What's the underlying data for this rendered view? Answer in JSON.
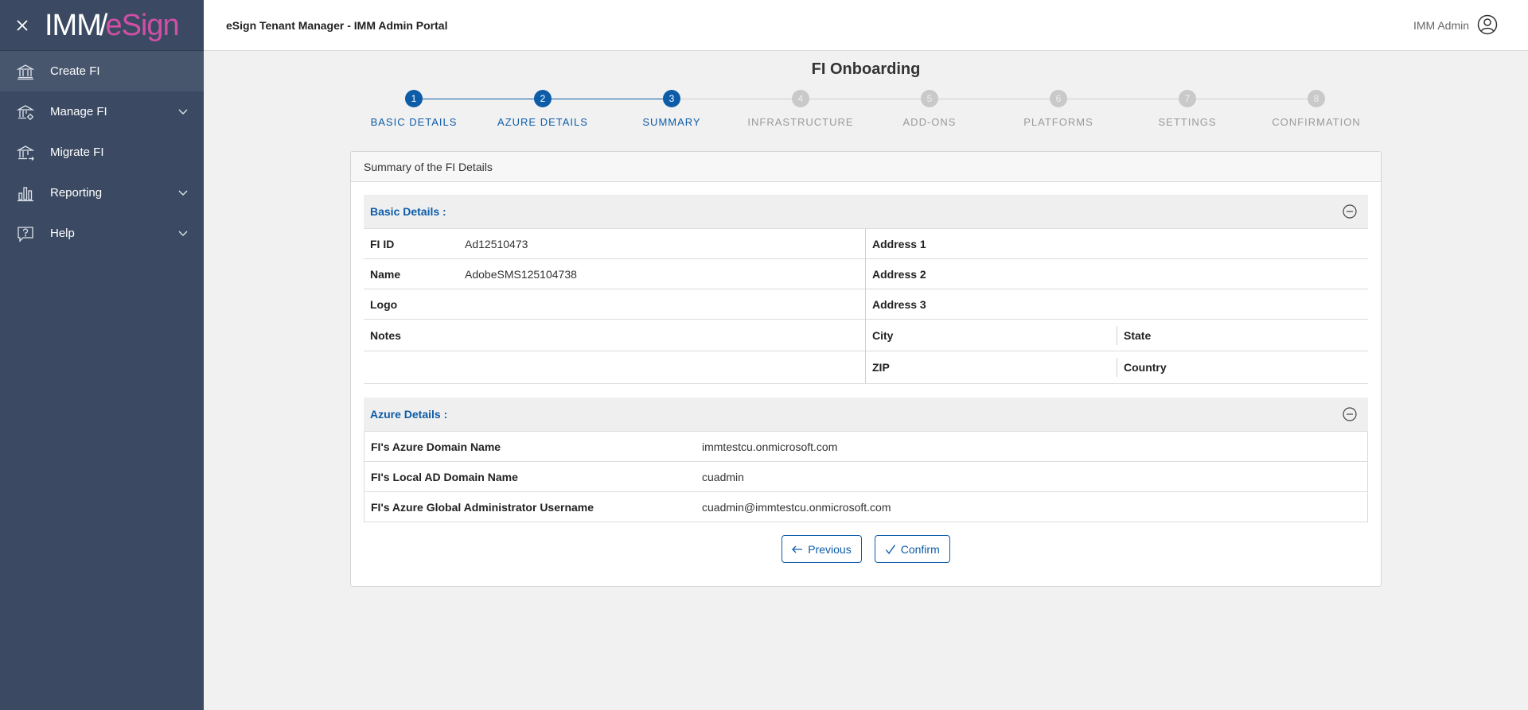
{
  "sidebar": {
    "logo": {
      "part1": "IMM",
      "part2": "/",
      "part3": "eSign"
    },
    "items": [
      {
        "label": "Create FI",
        "icon": "bank-icon",
        "active": true
      },
      {
        "label": "Manage FI",
        "icon": "bank-gear-icon",
        "expandable": true
      },
      {
        "label": "Migrate FI",
        "icon": "bank-migrate-icon"
      },
      {
        "label": "Reporting",
        "icon": "bar-chart-icon",
        "expandable": true
      },
      {
        "label": "Help",
        "icon": "help-icon",
        "expandable": true
      }
    ]
  },
  "header": {
    "title": "eSign Tenant Manager - IMM Admin Portal",
    "user": "IMM Admin"
  },
  "page": {
    "title": "FI Onboarding"
  },
  "stepper": {
    "steps": [
      {
        "num": "1",
        "label": "BASIC DETAILS",
        "state": "done"
      },
      {
        "num": "2",
        "label": "AZURE DETAILS",
        "state": "done"
      },
      {
        "num": "3",
        "label": "SUMMARY",
        "state": "done"
      },
      {
        "num": "4",
        "label": "INFRASTRUCTURE",
        "state": "todo"
      },
      {
        "num": "5",
        "label": "ADD-ONS",
        "state": "todo"
      },
      {
        "num": "6",
        "label": "PLATFORMS",
        "state": "todo"
      },
      {
        "num": "7",
        "label": "SETTINGS",
        "state": "todo"
      },
      {
        "num": "8",
        "label": "CONFIRMATION",
        "state": "todo"
      }
    ]
  },
  "summary": {
    "card_title": "Summary of the FI Details",
    "basic": {
      "title": "Basic Details :",
      "left": [
        {
          "label": "FI ID",
          "value": "Ad12510473"
        },
        {
          "label": "Name",
          "value": "AdobeSMS125104738"
        },
        {
          "label": "Logo",
          "value": ""
        },
        {
          "label": "Notes",
          "value": ""
        }
      ],
      "right": {
        "address1": "Address 1",
        "address2": "Address 2",
        "address3": "Address 3",
        "city": "City",
        "state": "State",
        "zip": "ZIP",
        "country": "Country"
      }
    },
    "azure": {
      "title": "Azure Details :",
      "rows": [
        {
          "label": "FI's Azure Domain Name",
          "value": "immtestcu.onmicrosoft.com"
        },
        {
          "label": "FI's Local AD Domain Name",
          "value": "cuadmin"
        },
        {
          "label": "FI's Azure Global Administrator Username",
          "value": "cuadmin@immtestcu.onmicrosoft.com"
        }
      ]
    }
  },
  "actions": {
    "previous": "Previous",
    "confirm": "Confirm"
  },
  "colors": {
    "sidebar_bg": "#3b4a62",
    "accent": "#0d5ca8",
    "logo_accent": "#d14fa6",
    "step_inactive": "#c9c9c9"
  }
}
